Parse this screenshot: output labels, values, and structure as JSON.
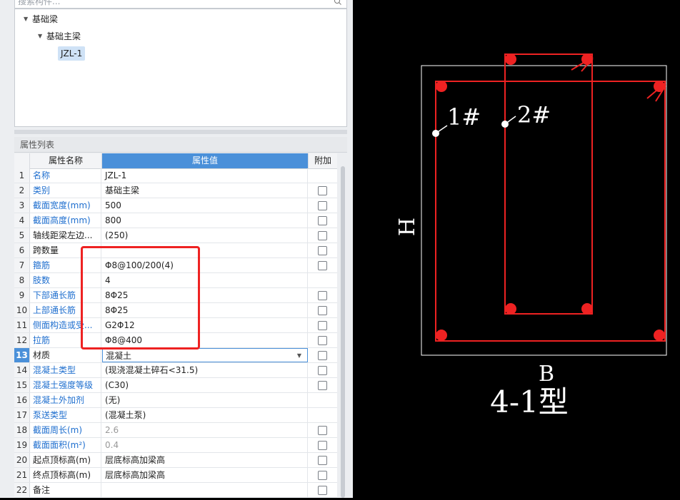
{
  "search": {
    "placeholder": "搜索构件..."
  },
  "tree": {
    "root": "基础梁",
    "child": "基础主梁",
    "leaf": "JZL-1"
  },
  "props": {
    "panel_title": "属性列表",
    "col_name": "属性名称",
    "col_value": "属性值",
    "col_extra": "附加",
    "rows": [
      {
        "n": "1",
        "name": "名称",
        "value": "JZL-1"
      },
      {
        "n": "2",
        "name": "类别",
        "value": "基础主梁"
      },
      {
        "n": "3",
        "name": "截面宽度(mm)",
        "value": "500"
      },
      {
        "n": "4",
        "name": "截面高度(mm)",
        "value": "800"
      },
      {
        "n": "5",
        "name": "轴线距梁左边...",
        "value": "(250)"
      },
      {
        "n": "6",
        "name": "跨数量",
        "value": ""
      },
      {
        "n": "7",
        "name": "箍筋",
        "value": "Φ8@100/200(4)"
      },
      {
        "n": "8",
        "name": "肢数",
        "value": "4"
      },
      {
        "n": "9",
        "name": "下部通长筋",
        "value": "8Φ25"
      },
      {
        "n": "10",
        "name": "上部通长筋",
        "value": "8Φ25"
      },
      {
        "n": "11",
        "name": "侧面构造或受...",
        "value": "G2Φ12"
      },
      {
        "n": "12",
        "name": "拉筋",
        "value": "Φ8@400"
      },
      {
        "n": "13",
        "name": "材质",
        "value": "混凝土"
      },
      {
        "n": "14",
        "name": "混凝土类型",
        "value": "(现浇混凝土碎石<31.5)"
      },
      {
        "n": "15",
        "name": "混凝土强度等级",
        "value": "(C30)"
      },
      {
        "n": "16",
        "name": "混凝土外加剂",
        "value": "(无)"
      },
      {
        "n": "17",
        "name": "泵送类型",
        "value": "(混凝土泵)"
      },
      {
        "n": "18",
        "name": "截面周长(m)",
        "value": "2.6"
      },
      {
        "n": "19",
        "name": "截面面积(m²)",
        "value": "0.4"
      },
      {
        "n": "20",
        "name": "起点顶标高(m)",
        "value": "层底标高加梁高"
      },
      {
        "n": "21",
        "name": "终点顶标高(m)",
        "value": "层底标高加梁高"
      },
      {
        "n": "22",
        "name": "备注",
        "value": ""
      }
    ]
  },
  "cad": {
    "label_1": "1#",
    "label_2": "2#",
    "dim_h": "H",
    "dim_b": "B",
    "type_label": "4-1型"
  },
  "colors": {
    "accent": "#4a90d9",
    "rebar": "#ee2222",
    "link": "#1f6fcf"
  }
}
